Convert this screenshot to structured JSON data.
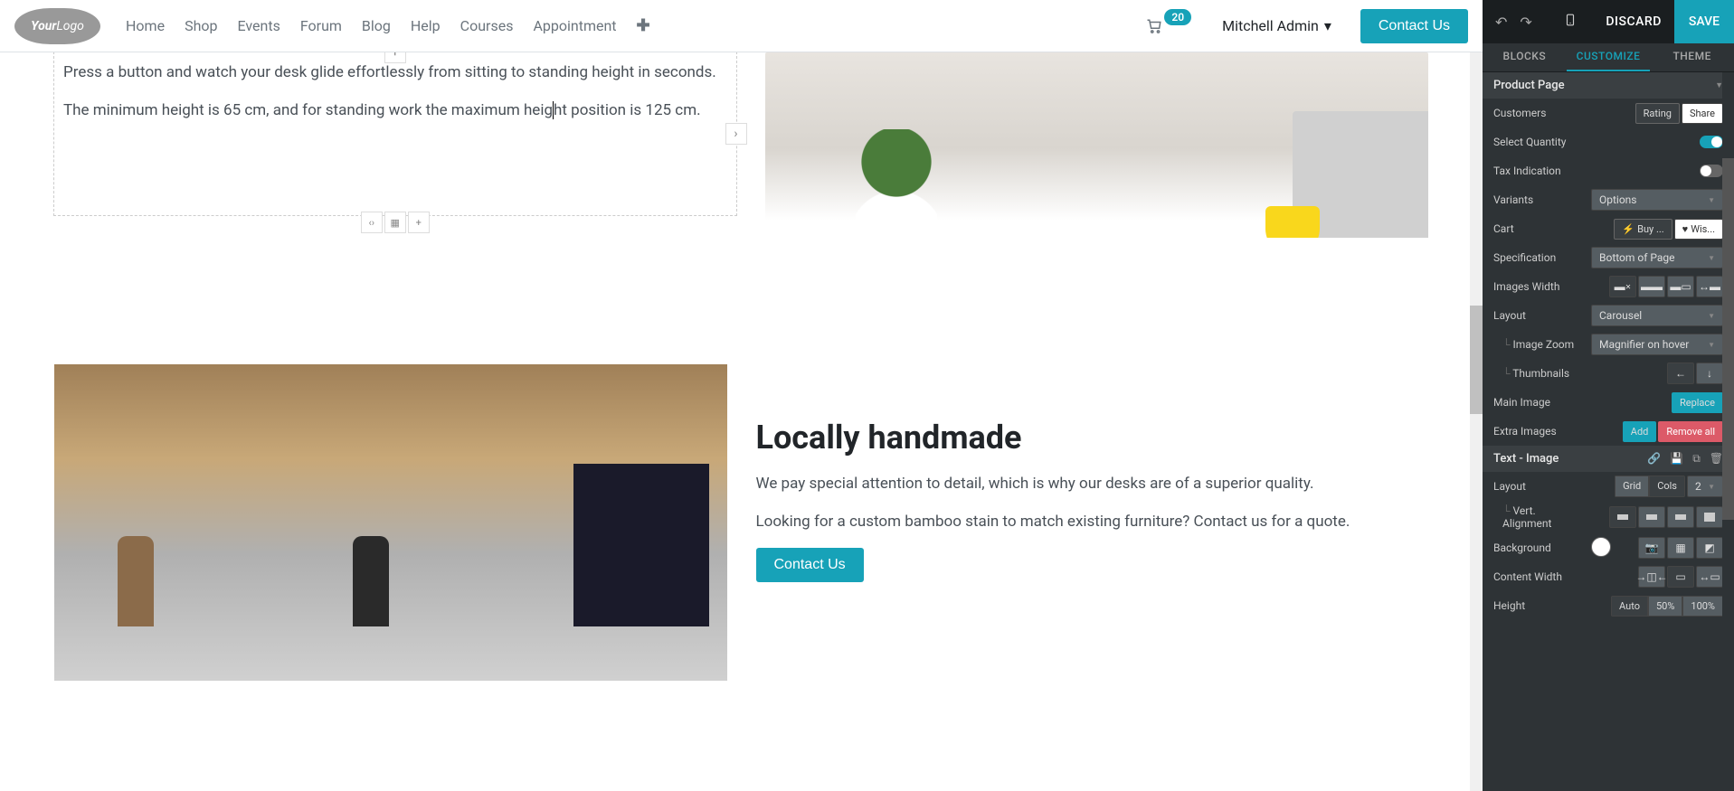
{
  "topbar": {
    "logo_text1": "Your",
    "logo_text2": "Logo",
    "nav": [
      "Home",
      "Shop",
      "Events",
      "Forum",
      "Blog",
      "Help",
      "Courses",
      "Appointment"
    ],
    "cart_count": "20",
    "user_name": "Mitchell Admin",
    "contact_btn": "Contact Us"
  },
  "content": {
    "sec1_p1": "Press a button and watch your desk glide effortlessly from sitting to standing height in seconds.",
    "sec1_p2_a": "The minimum height is 65 cm, and for standing work the maximum heig",
    "sec1_p2_b": "ht position is 125 cm.",
    "sec2_h": "Locally handmade",
    "sec2_p1": "We pay special attention to detail, which is why our desks are of a superior quality.",
    "sec2_p2": "Looking for a custom bamboo stain to match existing furniture? Contact us for a quote.",
    "sec2_btn": "Contact Us"
  },
  "editor": {
    "discard": "DISCARD",
    "save": "SAVE",
    "tabs": [
      "BLOCKS",
      "CUSTOMIZE",
      "THEME"
    ],
    "section1_header": "Product Page",
    "section2_header": "Text - Image",
    "props": {
      "customers": "Customers",
      "rating": "Rating",
      "share": "Share",
      "select_qty": "Select Quantity",
      "tax": "Tax Indication",
      "variants": "Variants",
      "variants_val": "Options",
      "cart": "Cart",
      "buy": "Buy ...",
      "wish": "Wis...",
      "spec": "Specification",
      "spec_val": "Bottom of Page",
      "img_width": "Images Width",
      "layout": "Layout",
      "layout_val": "Carousel",
      "img_zoom": "Image Zoom",
      "img_zoom_val": "Magnifier on hover",
      "thumbnails": "Thumbnails",
      "main_img": "Main Image",
      "replace": "Replace",
      "extra_img": "Extra Images",
      "add": "Add",
      "remove_all": "Remove all",
      "layout2": "Layout",
      "grid": "Grid",
      "cols": "Cols",
      "cols_val": "2",
      "valign": "Vert. Alignment",
      "bg": "Background",
      "content_width": "Content Width",
      "height": "Height",
      "auto": "Auto",
      "h50": "50%",
      "h100": "100%"
    }
  }
}
